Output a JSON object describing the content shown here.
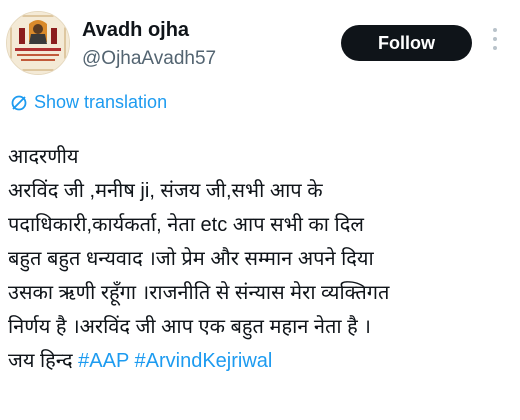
{
  "user": {
    "display_name": "Avadh ojha",
    "handle": "@OjhaAvadh57"
  },
  "follow_button_label": "Follow",
  "show_translation_label": "Show translation",
  "tweet": {
    "line1": "आदरणीय",
    "line2": "अरविंद जी ,मनीष ji, संजय जी,सभी आप के",
    "line3": "पदाधिकारी,कार्यकर्ता, नेता etc आप सभी का दिल",
    "line4": "बहुत बहुत धन्यवाद ।जो प्रेम और सम्मान अपने दिया",
    "line5": "उसका ऋणी रहूँगा ।राजनीति से संन्यास मेरा व्यक्तिगत",
    "line6": "निर्णय है ।अरविंद जी आप एक बहुत महान नेता है ।",
    "line7_text": "जय हिन्द ",
    "hashtag1": "#AAP",
    "hashtag2": "#ArvindKejriwal"
  },
  "colors": {
    "accent": "#1d9bf0",
    "follow_bg": "#0f1419",
    "handle": "#536471"
  },
  "icons": {
    "avatar": "profile-picture",
    "more": "vertical-dots-icon",
    "translate": "translate-icon"
  }
}
